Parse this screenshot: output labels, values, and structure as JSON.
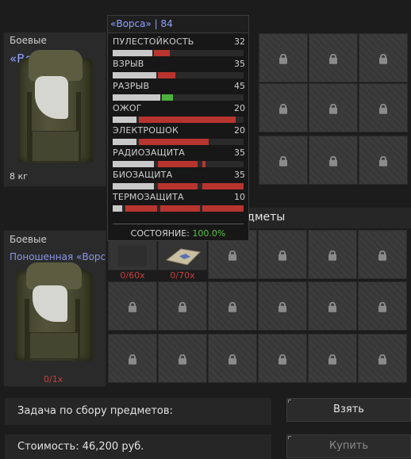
{
  "top_item": {
    "category": "Боевые",
    "name": "«Ворса»",
    "weight": "8 кг"
  },
  "bottom_item": {
    "category": "Боевые",
    "name": "Поношенная «Ворса»",
    "quantity": "0/1x"
  },
  "mini_slots": [
    {
      "quantity": "0/60x"
    },
    {
      "quantity": "0/70x"
    }
  ],
  "section": {
    "title": "Необходимые предметы"
  },
  "tooltip": {
    "title": "«Ворса» | 84",
    "stats": [
      {
        "name": "ПУЛЕСТОЙКОСТЬ",
        "value": "32"
      },
      {
        "name": "ВЗРЫВ",
        "value": "35"
      },
      {
        "name": "РАЗРЫВ",
        "value": "45"
      },
      {
        "name": "ОЖОГ",
        "value": "20"
      },
      {
        "name": "ЭЛЕКТРОШОК",
        "value": "20"
      },
      {
        "name": "РАДИОЗАЩИТА",
        "value": "35"
      },
      {
        "name": "БИОЗАЩИТА",
        "value": "35"
      },
      {
        "name": "ТЕРМОЗАЩИТА",
        "value": "10"
      }
    ],
    "condition_label": "СОСТОЯНИЕ:",
    "condition_value": "100.0%"
  },
  "task": {
    "label": "Задача по сбору предметов:",
    "take_button": "Взять"
  },
  "cost": {
    "label": "Стоимость: 46,200 руб.",
    "buy_button": "Купить"
  },
  "colors": {
    "bar_gray": "#c9c9c9",
    "bar_red": "#b8342f",
    "bar_green": "#4bb33c",
    "accent_name": "#8fa0ff"
  }
}
